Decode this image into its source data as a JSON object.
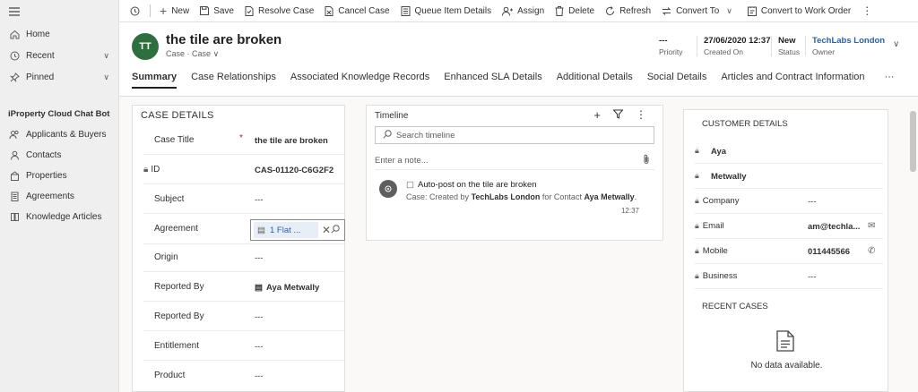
{
  "sidebar": {
    "nav": [
      {
        "label": "Home",
        "icon": "home-icon"
      },
      {
        "label": "Recent",
        "icon": "clock-icon"
      },
      {
        "label": "Pinned",
        "icon": "pin-icon"
      }
    ],
    "group_title": "iProperty Cloud Chat Bot",
    "items": [
      {
        "label": "Applicants & Buyers",
        "icon": "people-icon"
      },
      {
        "label": "Contacts",
        "icon": "person-icon"
      },
      {
        "label": "Properties",
        "icon": "building-icon"
      },
      {
        "label": "Agreements",
        "icon": "document-icon"
      },
      {
        "label": "Knowledge Articles",
        "icon": "book-icon"
      }
    ]
  },
  "toolbar": {
    "new": "New",
    "save": "Save",
    "resolve_case": "Resolve Case",
    "cancel_case": "Cancel Case",
    "queue_item_details": "Queue Item Details",
    "assign": "Assign",
    "delete": "Delete",
    "refresh": "Refresh",
    "convert_to": "Convert To",
    "convert_to_work_order": "Convert to Work Order"
  },
  "header": {
    "avatar_initials": "TT",
    "title": "the tile are broken",
    "entity": "Case",
    "form": "Case",
    "priority_value": "---",
    "priority_label": "Priority",
    "created_value": "27/06/2020 12:37",
    "created_label": "Created On",
    "status_value": "New",
    "status_label": "Status",
    "owner_value": "TechLabs London",
    "owner_label": "Owner"
  },
  "tabs": [
    "Summary",
    "Case Relationships",
    "Associated Knowledge Records",
    "Enhanced SLA Details",
    "Additional Details",
    "Social Details",
    "Articles and Contract Information",
    "···"
  ],
  "case_details": {
    "title": "CASE DETAILS",
    "case_title_label": "Case Title",
    "case_title_value": "the tile are broken",
    "id_label": "ID",
    "id_value": "CAS-01120-C6G2F2",
    "subject_label": "Subject",
    "subject_value": "---",
    "agreement_label": "Agreement",
    "agreement_value": "1 Flat ...",
    "origin_label": "Origin",
    "origin_value": "---",
    "reported_by_label": "Reported By",
    "reported_by_value": "Aya Metwally",
    "reported_by2_label": "Reported By",
    "reported_by2_value": "---",
    "entitlement_label": "Entitlement",
    "entitlement_value": "---",
    "product_label": "Product",
    "product_value": "---"
  },
  "timeline": {
    "title": "Timeline",
    "search_placeholder": "Search timeline",
    "note_placeholder": "Enter a note...",
    "post_title": "Auto-post on the tile are broken",
    "post_prefix": "Case: Created by",
    "post_creator": "TechLabs London",
    "post_middle": "for Contact",
    "post_contact": "Aya Metwally",
    "post_suffix": ".",
    "post_time": "12:37"
  },
  "customer": {
    "title": "CUSTOMER DETAILS",
    "first_name": "Aya",
    "last_name": "Metwally",
    "company_label": "Company",
    "company_value": "---",
    "email_label": "Email",
    "email_value": "am@techla...",
    "mobile_label": "Mobile",
    "mobile_value": "011445566",
    "business_label": "Business",
    "business_value": "---",
    "recent_title": "RECENT CASES",
    "no_data": "No data available."
  }
}
